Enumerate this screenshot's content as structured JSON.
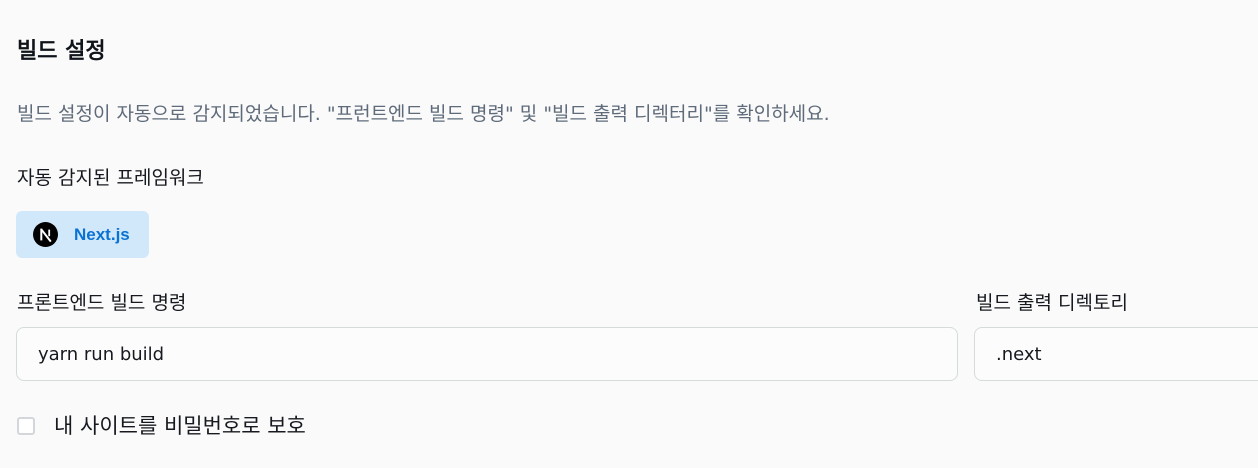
{
  "build_settings": {
    "title": "빌드 설정",
    "description": "빌드 설정이 자동으로 감지되었습니다. \"프런트엔드 빌드 명령\" 및 \"빌드 출력 디렉터리\"를 확인하세요.",
    "framework": {
      "label": "자동 감지된 프레임워크",
      "name": "Next.js",
      "icon": "nextjs-logo-icon"
    },
    "build_command": {
      "label": "프론트엔드 빌드 명령",
      "value": "yarn run build"
    },
    "output_directory": {
      "label": "빌드 출력 디렉토리",
      "value": ".next"
    },
    "password_protect": {
      "label": "내 사이트를 비밀번호로 보호",
      "checked": false
    }
  },
  "colors": {
    "background": "#fafafa",
    "badge_background": "#d1e8fb",
    "badge_text": "#0972d3",
    "description_text": "#5f6b7a",
    "input_border": "#d5dbdb"
  }
}
